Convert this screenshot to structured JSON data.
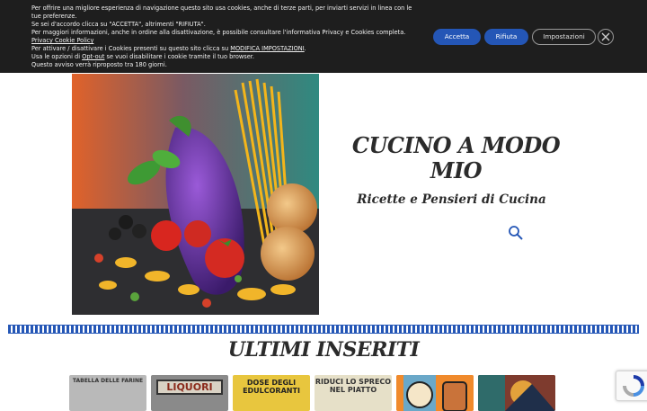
{
  "cookie_banner": {
    "line1": "Per offrire una migliore esperienza di navigazione questo sito usa cookies, anche di terze parti, per inviarti servizi in linea con le tue preferenze.",
    "line2": "Se sei d'accordo clicca su \"ACCETTA\", altrimenti \"RIFIUTA\".",
    "line3_pre": "Per maggiori informazioni, anche in ordine alla disattivazione, è possibile consultare l'informativa Privacy e Cookies completa. ",
    "line3_link": "Privacy Cookie Policy",
    "line4_pre": "Per attivare / disattivare i Cookies presenti su questo sito clicca su ",
    "line4_link": "MODIFICA IMPOSTAZIONI",
    "line4_post": ".",
    "line5_pre": "Usa le opzioni di ",
    "line5_link": "Opt-out",
    "line5_post": " se vuoi disabilitare i cookie tramite il tuo browser.",
    "line6": "Questo avviso verrà riproposto tra 180 giorni.",
    "accept_label": "Accetta",
    "reject_label": "Rifiuta",
    "settings_label": "Impostazioni"
  },
  "header": {
    "site_title": "CUCINO A MODO MIO",
    "tagline": "Ricette e Pensieri di Cucina"
  },
  "section": {
    "title": "ULTIMI INSERITI"
  },
  "thumbnails": {
    "t1": "TABELLA DELLE FARINE",
    "t2": "LIQUORI",
    "t3": "DOSE DEGLI EDULCORANTI",
    "t4": "RIDUCI LO SPRECO NEL PIATTO"
  },
  "colors": {
    "accent": "#2456b6",
    "banner_bg": "#1e1e1e",
    "title": "#2b2b2b"
  }
}
